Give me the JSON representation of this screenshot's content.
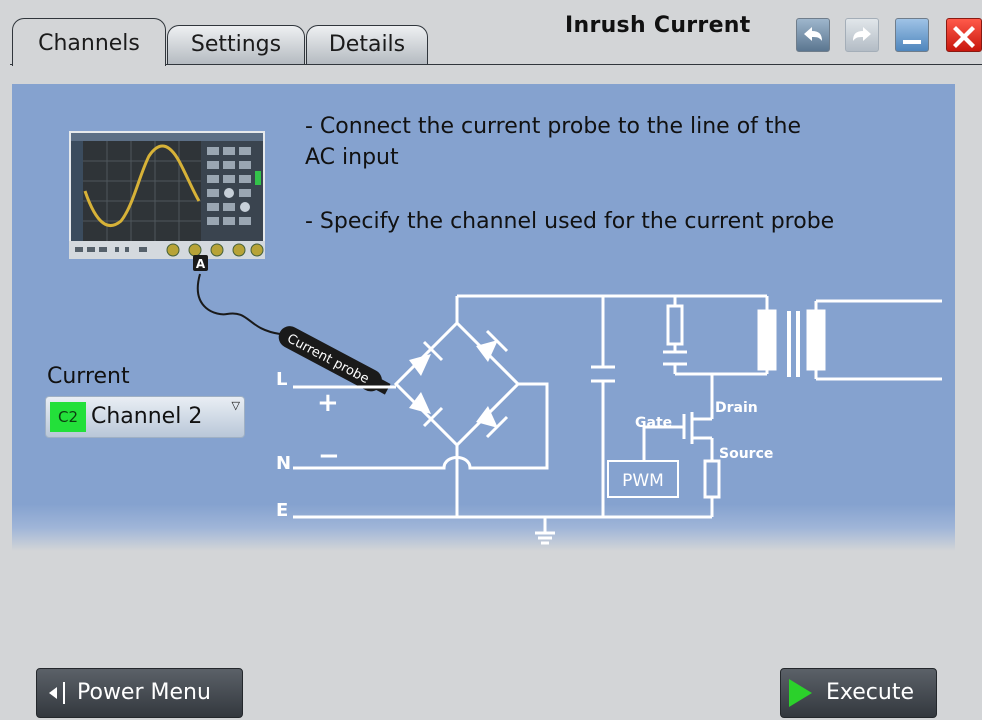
{
  "tabs": [
    {
      "label": "Channels",
      "active": true
    },
    {
      "label": "Settings",
      "active": false
    },
    {
      "label": "Details",
      "active": false
    }
  ],
  "window": {
    "title": "Inrush Current",
    "buttons": [
      "undo-icon",
      "redo-icon",
      "minimize-icon",
      "close-icon"
    ]
  },
  "instructions": {
    "line1": "- Connect the current probe to the line of the",
    "line2": "AC input",
    "line3": "- Specify the channel used for the current probe"
  },
  "diagram": {
    "scope_connector": "A",
    "probe_label": "Current probe",
    "line_L": "L",
    "line_N": "N",
    "line_E": "E",
    "plus": "+",
    "minus": "−",
    "gate": "Gate",
    "drain": "Drain",
    "source": "Source",
    "pwm": "PWM"
  },
  "current": {
    "label": "Current",
    "badge": "C2",
    "channel": "Channel 2",
    "badge_color": "#23e03a"
  },
  "footer": {
    "power_menu": "Power Menu",
    "execute": "Execute"
  },
  "colors": {
    "panel": "#85a2cf",
    "close": "#e02418",
    "execute_icon": "#2bd12b"
  }
}
